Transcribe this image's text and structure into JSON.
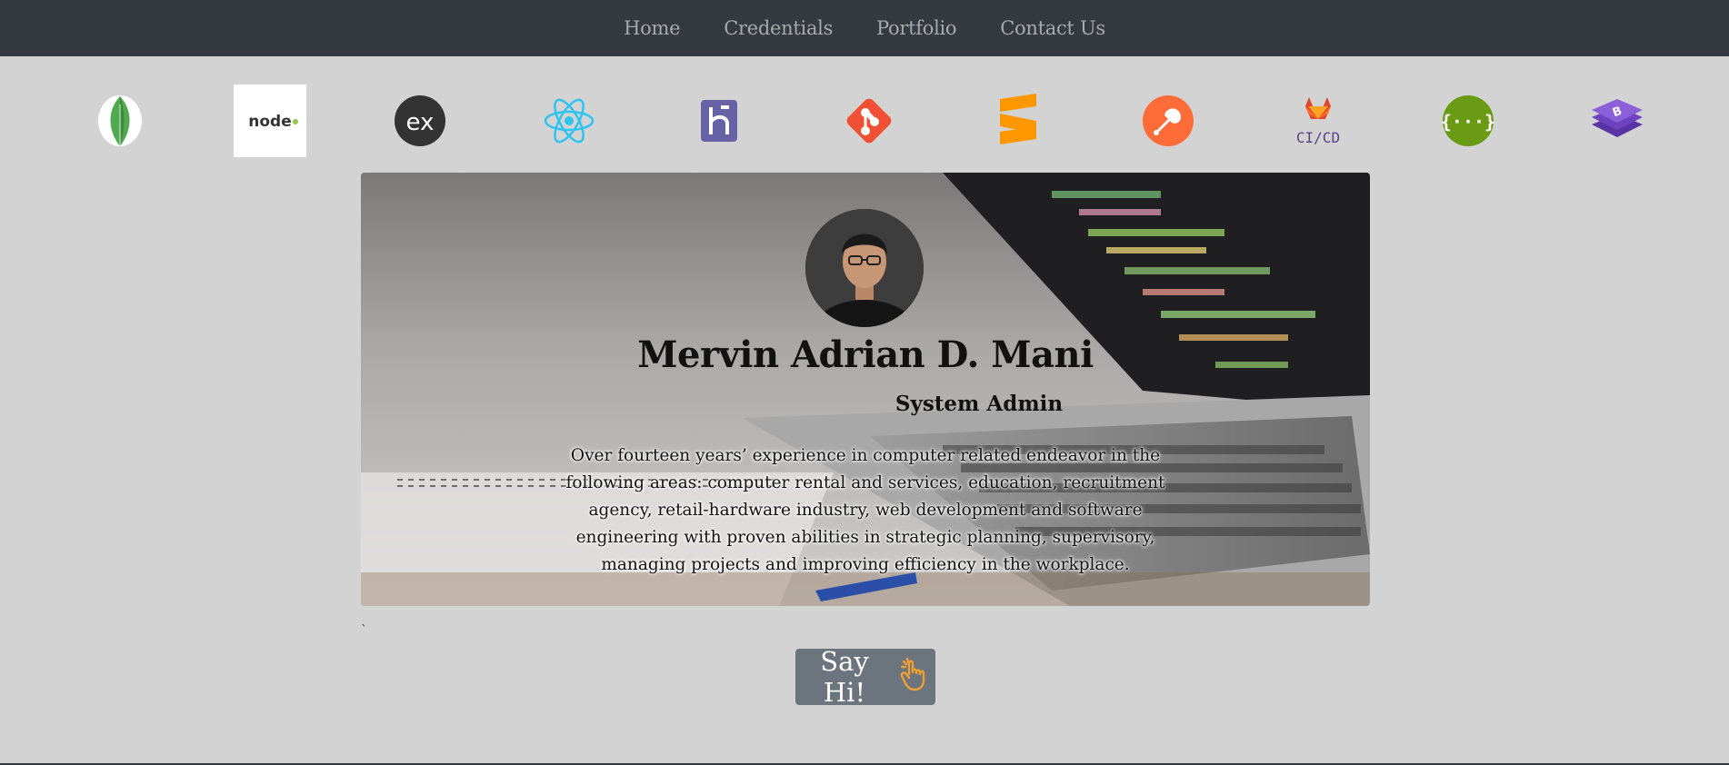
{
  "nav": {
    "items": [
      {
        "label": "Home"
      },
      {
        "label": "Credentials"
      },
      {
        "label": "Portfolio"
      },
      {
        "label": "Contact Us"
      }
    ]
  },
  "tech_icons": [
    {
      "icon": "mongodb-icon"
    },
    {
      "icon": "nodejs-icon",
      "text": "node"
    },
    {
      "icon": "express-icon",
      "text": "ex"
    },
    {
      "icon": "react-icon"
    },
    {
      "icon": "heroku-icon"
    },
    {
      "icon": "git-icon"
    },
    {
      "icon": "sublime-text-icon"
    },
    {
      "icon": "postman-icon"
    },
    {
      "icon": "gitlab-cicd-icon",
      "text": "CI/CD"
    },
    {
      "icon": "swagger-icon",
      "text": "{···}"
    },
    {
      "icon": "bootstrap-icon"
    }
  ],
  "hero": {
    "name": "Mervin Adrian D. Mani",
    "role": "System Admin",
    "bio": "Over fourteen years’ experience in computer related endeavor in the following areas: computer rental and services, education, recruitment agency, retail-hardware industry, web development and software engineering with proven abilities in strategic planning, supervisory, managing projects and improving efficiency in the workplace."
  },
  "stray_char": "`",
  "cta": {
    "label": "Say Hi!",
    "icon": "pointing-hand-icon"
  },
  "colors": {
    "navbar": "#343a40",
    "page_bg": "#d3d3d3",
    "button": "#6c757d",
    "hand": "#f0a030"
  }
}
